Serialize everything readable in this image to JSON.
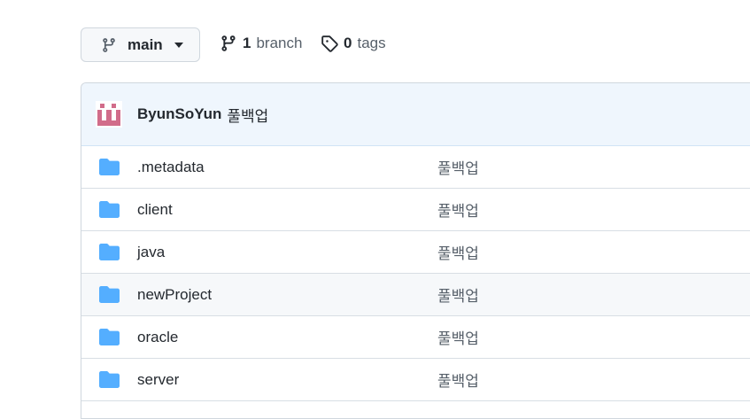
{
  "toolbar": {
    "branch_label": "main",
    "branches_count": "1",
    "branches_text": "branch",
    "tags_count": "0",
    "tags_text": "tags"
  },
  "commit": {
    "author": "ByunSoYun",
    "message": "풀백업"
  },
  "files": [
    {
      "name": ".metadata",
      "message": "풀백업",
      "icon": "folder-icon"
    },
    {
      "name": "client",
      "message": "풀백업",
      "icon": "folder-icon"
    },
    {
      "name": "java",
      "message": "풀백업",
      "icon": "folder-icon"
    },
    {
      "name": "newProject",
      "message": "풀백업",
      "icon": "folder-icon"
    },
    {
      "name": "oracle",
      "message": "풀백업",
      "icon": "folder-icon"
    },
    {
      "name": "server",
      "message": "풀백업",
      "icon": "folder-icon"
    }
  ],
  "colors": {
    "folder": "#54aeff",
    "avatar": "#d16c8a",
    "header_bg": "#eff6fd"
  }
}
